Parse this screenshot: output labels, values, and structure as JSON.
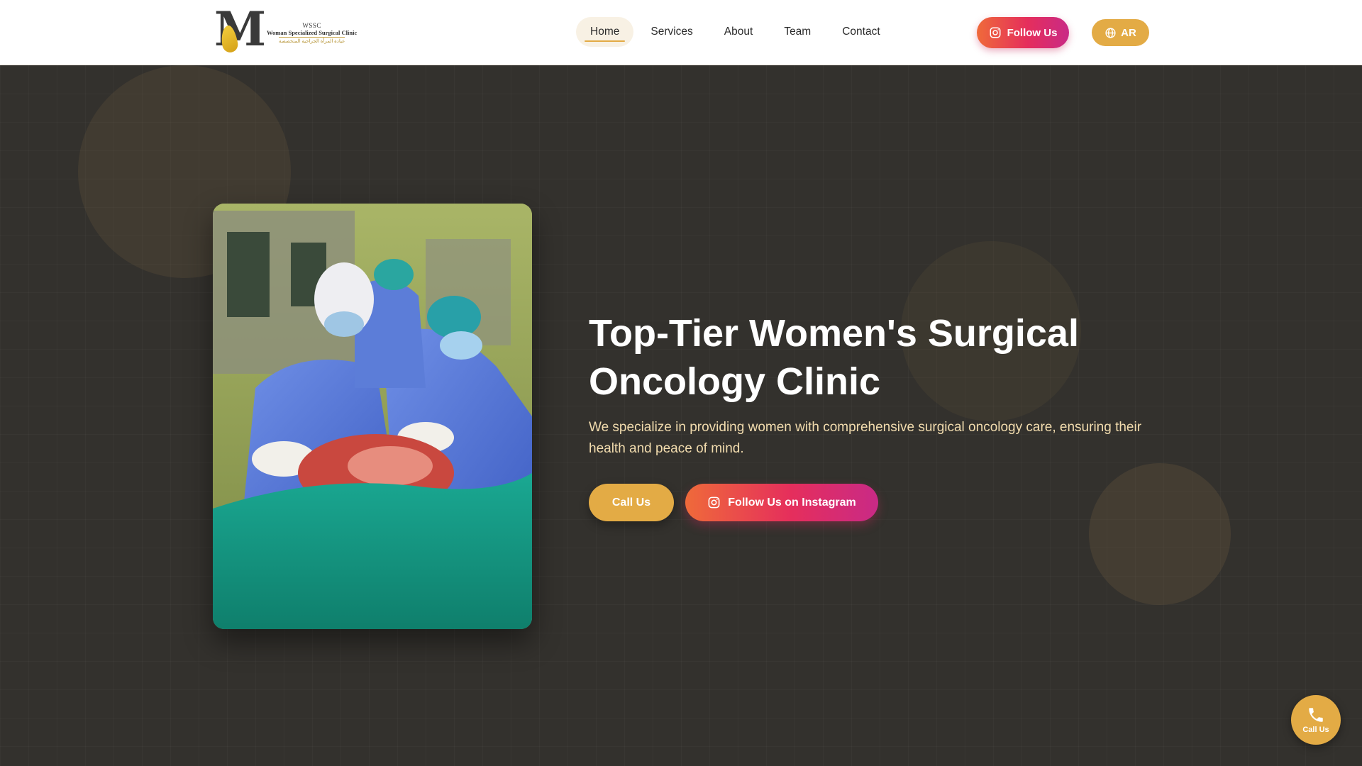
{
  "header": {
    "logo": {
      "letter": "M",
      "abbr": "WSSC",
      "name": "Woman Specialized Surgical Clinic",
      "arabic": "عيادة المرأة الجراحية المتخصصة"
    },
    "nav": [
      {
        "label": "Home",
        "active": true
      },
      {
        "label": "Services",
        "active": false
      },
      {
        "label": "About",
        "active": false
      },
      {
        "label": "Team",
        "active": false
      },
      {
        "label": "Contact",
        "active": false
      }
    ],
    "follow_label": "Follow Us",
    "lang_label": "AR",
    "icons": {
      "follow": "instagram-icon",
      "lang": "globe-icon"
    }
  },
  "hero": {
    "title": "Top-Tier Women's Surgical Oncology Clinic",
    "description": "We specialize in providing women with comprehensive surgical oncology care, ensuring their health and peace of mind.",
    "call_label": "Call Us",
    "instagram_label": "Follow Us on Instagram",
    "photo_alt": "Surgeons performing an operation"
  },
  "floating_call": {
    "label": "Call Us",
    "icon": "phone-icon"
  },
  "colors": {
    "accent_gold": "#e3ab45",
    "instagram_gradient_start": "#ef6a3a",
    "instagram_gradient_end": "#c92a86",
    "hero_bg": "#33312d",
    "hero_desc": "#f2dcae"
  }
}
